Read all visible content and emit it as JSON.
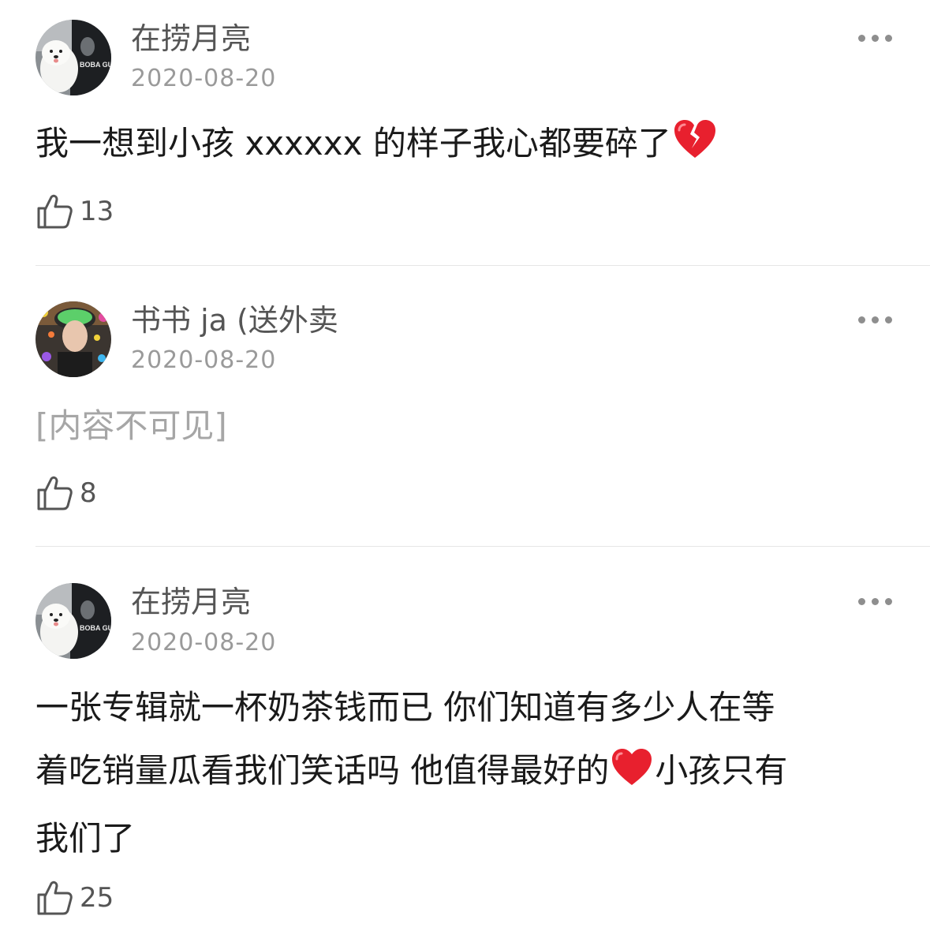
{
  "comments": [
    {
      "username": "在捞月亮",
      "date": "2020-08-20",
      "content_before": "我一想到小孩 xxxxxx 的样子我心都要碎了",
      "content_emoji": "broken-heart",
      "likes": "13",
      "avatar": "samoyed-dog-photo"
    },
    {
      "username": "书书 ja (送外卖",
      "date": "2020-08-20",
      "content": "[内容不可见]",
      "likes": "8",
      "avatar": "person-photo-with-flowers"
    },
    {
      "username": "在捞月亮",
      "date": "2020-08-20",
      "content_line1": "一张专辑就一杯奶茶钱而已 你们知道有多少人在等",
      "content_line2_before": "着吃销量瓜看我们笑话吗 他值得最好的",
      "content_emoji": "red-heart",
      "content_line2_after": "小孩只有",
      "content_line3": "我们了",
      "likes": "25",
      "avatar": "samoyed-dog-photo"
    }
  ],
  "icons": {
    "like": "thumbs-up-icon",
    "more": "more-dots-icon"
  },
  "colors": {
    "text": "#1a1a1a",
    "username": "#555555",
    "date": "#9a9a9a",
    "hidden_text": "#a6a6a6",
    "divider": "#e6e6e6",
    "heart_red": "#e8202e"
  }
}
